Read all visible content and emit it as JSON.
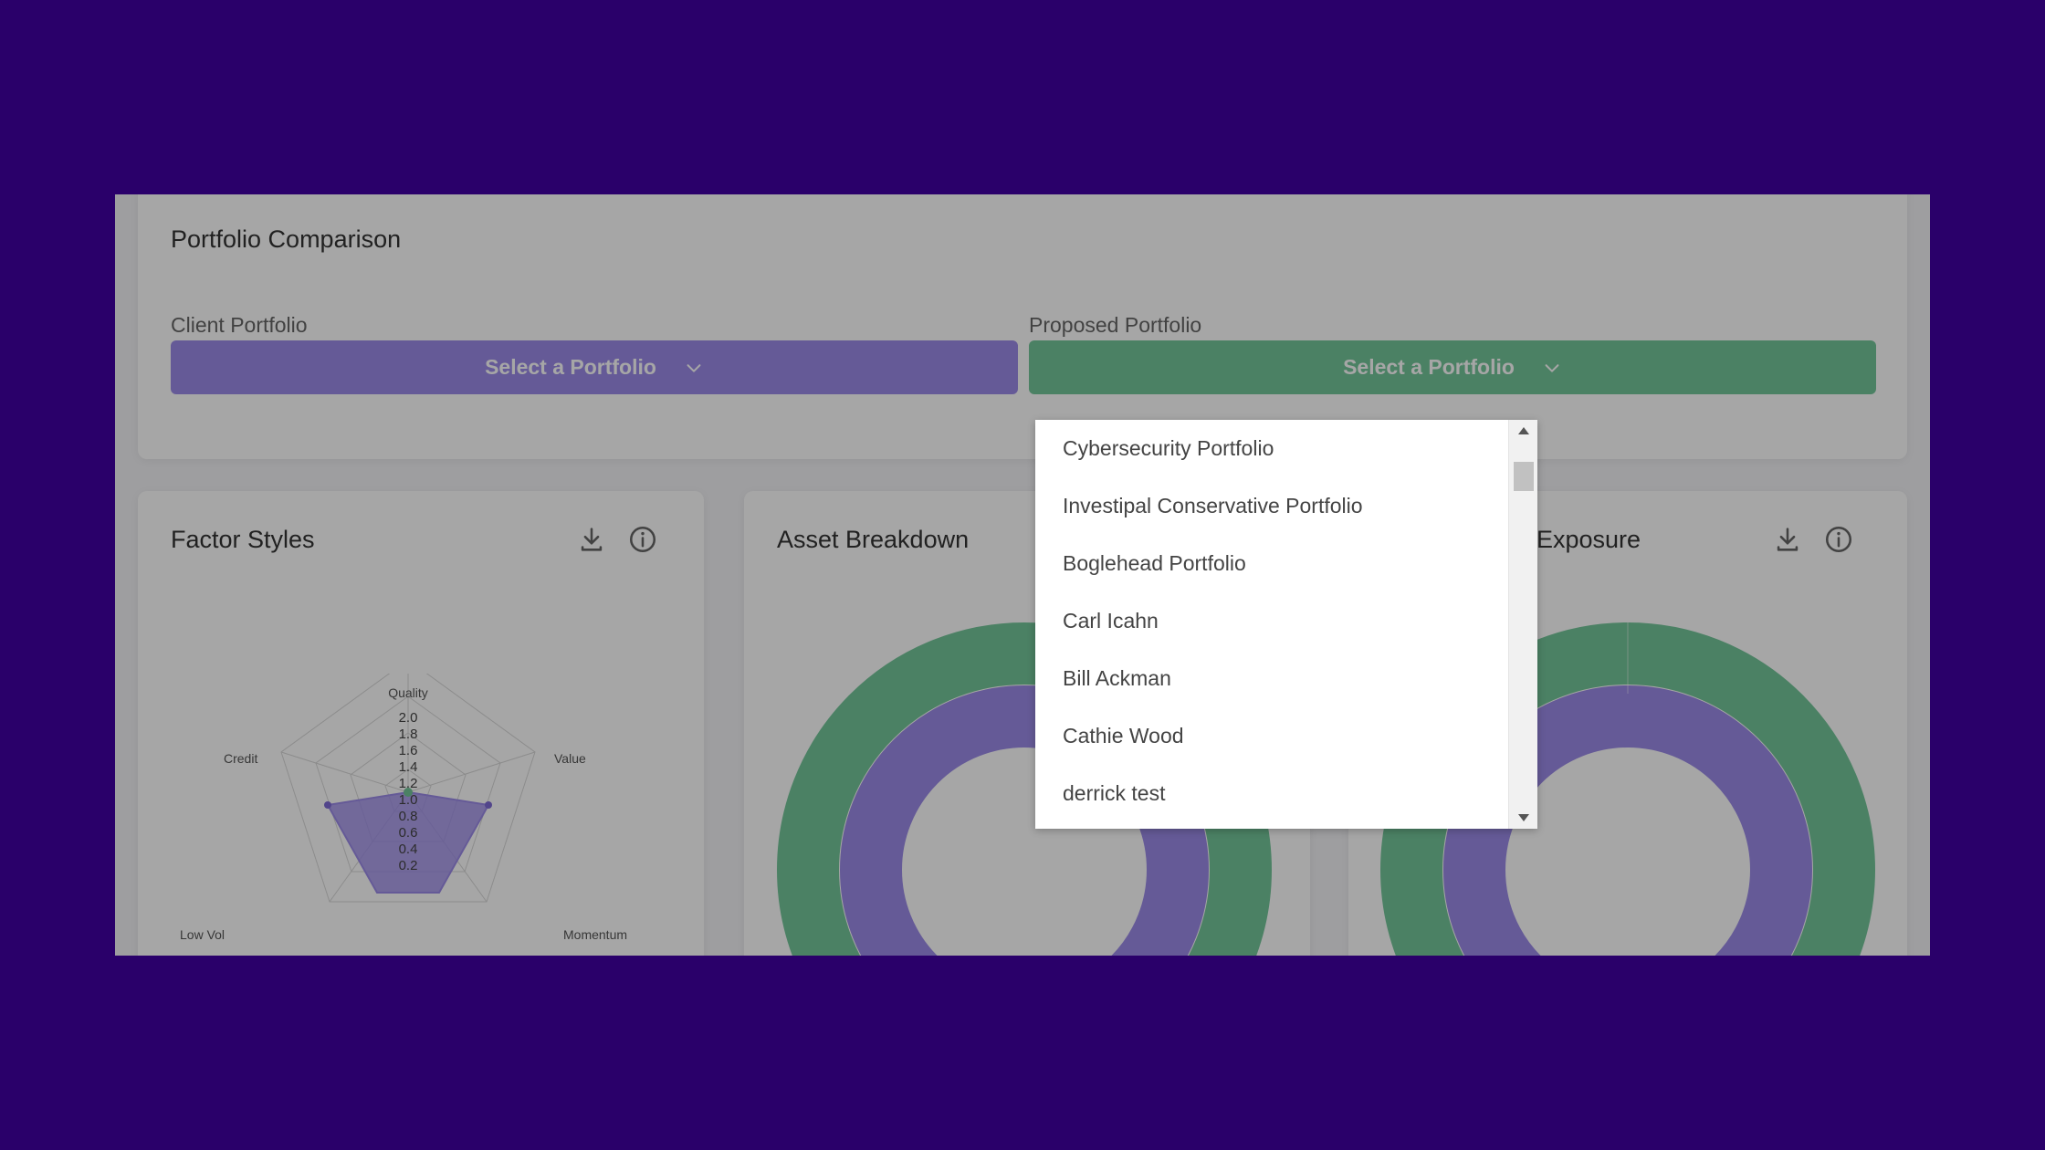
{
  "comparison": {
    "title": "Portfolio Comparison",
    "client_label": "Client Portfolio",
    "client_select": "Select a Portfolio",
    "proposed_label": "Proposed Portfolio",
    "proposed_select": "Select a Portfolio"
  },
  "cards": {
    "factor_styles": {
      "title": "Factor Styles"
    },
    "asset_breakdown": {
      "title": "Asset Breakdown"
    },
    "exposure": {
      "title": "Exposure"
    }
  },
  "radar": {
    "axes": [
      "Quality",
      "Value",
      "Momentum",
      "Low Vol",
      "Credit"
    ],
    "ticks": [
      "2.0",
      "1.8",
      "1.6",
      "1.4",
      "1.2",
      "1.0",
      "0.8",
      "0.6",
      "0.4",
      "0.2"
    ]
  },
  "dropdown": {
    "items": [
      "Cybersecurity Portfolio",
      "Investipal Conservative Portfolio",
      "Boglehead Portfolio",
      "Carl Icahn",
      "Bill Ackman",
      "Cathie Wood",
      "derrick test"
    ]
  },
  "colors": {
    "purple": "#9b8ae8",
    "green": "#74c69a",
    "background": "#2a006a"
  },
  "icons": {
    "download": "download-icon",
    "info": "info-icon",
    "chevron": "chevron-down-icon"
  }
}
